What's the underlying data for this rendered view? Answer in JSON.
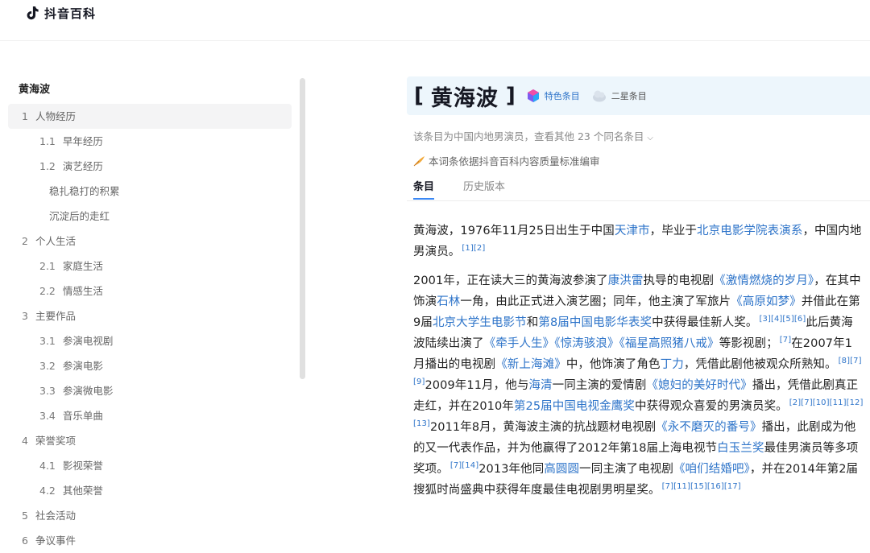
{
  "brand": {
    "name": "抖音百科"
  },
  "toc": {
    "title": "黄海波",
    "items": [
      {
        "num": "1",
        "label": "人物经历",
        "level": 1,
        "active": true
      },
      {
        "num": "1.1",
        "label": "早年经历",
        "level": 2
      },
      {
        "num": "1.2",
        "label": "演艺经历",
        "level": 2
      },
      {
        "num": "",
        "label": "稳扎稳打的积累",
        "level": 3
      },
      {
        "num": "",
        "label": "沉淀后的走红",
        "level": 3
      },
      {
        "num": "2",
        "label": "个人生活",
        "level": 1
      },
      {
        "num": "2.1",
        "label": "家庭生活",
        "level": 2
      },
      {
        "num": "2.2",
        "label": "情感生活",
        "level": 2
      },
      {
        "num": "3",
        "label": "主要作品",
        "level": 1
      },
      {
        "num": "3.1",
        "label": "参演电视剧",
        "level": 2
      },
      {
        "num": "3.2",
        "label": "参演电影",
        "level": 2
      },
      {
        "num": "3.3",
        "label": "参演微电影",
        "level": 2
      },
      {
        "num": "3.4",
        "label": "音乐单曲",
        "level": 2
      },
      {
        "num": "4",
        "label": "荣誉奖项",
        "level": 1
      },
      {
        "num": "4.1",
        "label": "影视荣誉",
        "level": 2
      },
      {
        "num": "4.2",
        "label": "其他荣誉",
        "level": 2
      },
      {
        "num": "5",
        "label": "社会活动",
        "level": 1
      },
      {
        "num": "6",
        "label": "争议事件",
        "level": 1
      }
    ]
  },
  "entry": {
    "bracket_open": "[",
    "title": "黄海波",
    "bracket_close": "]",
    "badge_featured": "特色条目",
    "badge_star": "二星条目",
    "disambiguation": "该条目为中国内地男演员，查看其他 23 个同名条目",
    "quality_note": "本词条依据抖音百科内容质量标准编审",
    "tabs": [
      "条目",
      "历史版本"
    ]
  },
  "colors": {
    "link": "#2e74c9",
    "tab_underline": "#3b88f5",
    "title_bg": "#edf6fc"
  },
  "article": {
    "paragraphs": [
      [
        {
          "t": "text",
          "v": "黄海波，1976年11月25日出生于中国"
        },
        {
          "t": "link",
          "v": "天津市"
        },
        {
          "t": "text",
          "v": "，毕业于"
        },
        {
          "t": "link",
          "v": "北京电影学院表演系"
        },
        {
          "t": "text",
          "v": "，中国内地男演员。"
        },
        {
          "t": "ref",
          "v": "[1][2]"
        }
      ],
      [
        {
          "t": "text",
          "v": "2001年，正在读大三的黄海波参演了"
        },
        {
          "t": "link",
          "v": "康洪雷"
        },
        {
          "t": "text",
          "v": "执导的电视剧"
        },
        {
          "t": "link",
          "v": "《激情燃烧的岁月》"
        },
        {
          "t": "text",
          "v": "，在其中饰演"
        },
        {
          "t": "link",
          "v": "石林"
        },
        {
          "t": "text",
          "v": "一角，由此正式进入演艺圈；同年，他主演了军旅片"
        },
        {
          "t": "link",
          "v": "《高原如梦》"
        },
        {
          "t": "text",
          "v": "并借此在第9届"
        },
        {
          "t": "link",
          "v": "北京大学生电影节"
        },
        {
          "t": "text",
          "v": "和"
        },
        {
          "t": "link",
          "v": "第8届中国电影华表奖"
        },
        {
          "t": "text",
          "v": "中获得最佳新人奖。"
        },
        {
          "t": "ref",
          "v": "[3][4][5][6]"
        },
        {
          "t": "text",
          "v": "此后黄海波陆续出演了"
        },
        {
          "t": "link",
          "v": "《牵手人生》"
        },
        {
          "t": "link",
          "v": "《惊涛骇浪》"
        },
        {
          "t": "link",
          "v": "《福星高照猪八戒》"
        },
        {
          "t": "text",
          "v": "等影视剧；"
        },
        {
          "t": "ref",
          "v": "[7]"
        },
        {
          "t": "text",
          "v": "在2007年1月播出的电视剧"
        },
        {
          "t": "link",
          "v": "《新上海滩》"
        },
        {
          "t": "text",
          "v": "中，他饰演了角色"
        },
        {
          "t": "link",
          "v": "丁力"
        },
        {
          "t": "text",
          "v": "，凭借此剧他被观众所熟知。"
        },
        {
          "t": "ref",
          "v": "[8][7][9]"
        },
        {
          "t": "text",
          "v": "2009年11月，他与"
        },
        {
          "t": "link",
          "v": "海清"
        },
        {
          "t": "text",
          "v": "一同主演的爱情剧"
        },
        {
          "t": "link",
          "v": "《媳妇的美好时代》"
        },
        {
          "t": "text",
          "v": "播出，凭借此剧真正走红，并在2010年"
        },
        {
          "t": "link",
          "v": "第25届中国电视金鹰奖"
        },
        {
          "t": "text",
          "v": "中获得观众喜爱的男演员奖。"
        },
        {
          "t": "ref",
          "v": "[2][7][10][11][12][13]"
        },
        {
          "t": "text",
          "v": "2011年8月，黄海波主演的抗战题材电视剧"
        },
        {
          "t": "link",
          "v": "《永不磨灭的番号》"
        },
        {
          "t": "text",
          "v": "播出，此剧成为他的又一代表作品，并为他赢得了2012年第18届上海电视节"
        },
        {
          "t": "link",
          "v": "白玉兰奖"
        },
        {
          "t": "text",
          "v": "最佳男演员等多项奖项。"
        },
        {
          "t": "ref",
          "v": "[7][14]"
        },
        {
          "t": "text",
          "v": "2013年他同"
        },
        {
          "t": "link",
          "v": "高圆圆"
        },
        {
          "t": "text",
          "v": "一同主演了电视剧"
        },
        {
          "t": "link",
          "v": "《咱们结婚吧》"
        },
        {
          "t": "text",
          "v": "，并在2014年第2届搜狐时尚盛典中获得年度最佳电视剧男明星奖。"
        },
        {
          "t": "ref",
          "v": "[7][11][15][16][17]"
        }
      ]
    ]
  }
}
